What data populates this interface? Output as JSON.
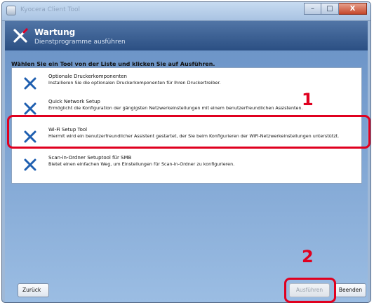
{
  "window": {
    "title": "Kyocera Client Tool"
  },
  "header": {
    "title": "Wartung",
    "subtitle": "Dienstprogramme ausführen"
  },
  "instruction": "Wählen Sie ein Tool von der Liste und klicken Sie auf Ausführen.",
  "tools": [
    {
      "name": "Optionale Druckerkomponenten",
      "description": "Installieren Sie die optionalen Druckerkomponenten für Ihren Druckertreiber."
    },
    {
      "name": "Quick Network Setup",
      "description": "Ermöglicht die Konfiguration der gängigsten Netzwerkeinstellungen mit einem benutzerfreundlichen Assistenten."
    },
    {
      "name": "Wi-Fi Setup Tool",
      "description": "Hiermit wird ein benutzerfreundlicher Assistent gestartet, der Sie beim Konfigurieren der WiFi-Netzwerkeinstellungen unterstützt."
    },
    {
      "name": "Scan-in-Ordner Setuptool für SMB",
      "description": "Bietet einen einfachen Weg, um Einstellungen für Scan-in-Ordner zu konfigurieren."
    }
  ],
  "annotations": {
    "step1": "1",
    "step2": "2"
  },
  "buttons": {
    "back": "Zurück",
    "run": "Ausführen",
    "end": "Beenden"
  },
  "window_controls": {
    "minimize": "–",
    "maximize": "□",
    "close": "X"
  },
  "colors": {
    "accent": "#2b4f83",
    "highlight": "#e0001f",
    "tool_icon": "#1f5fb0"
  },
  "icons": {
    "tool": "wrench-screwdriver-icon"
  }
}
